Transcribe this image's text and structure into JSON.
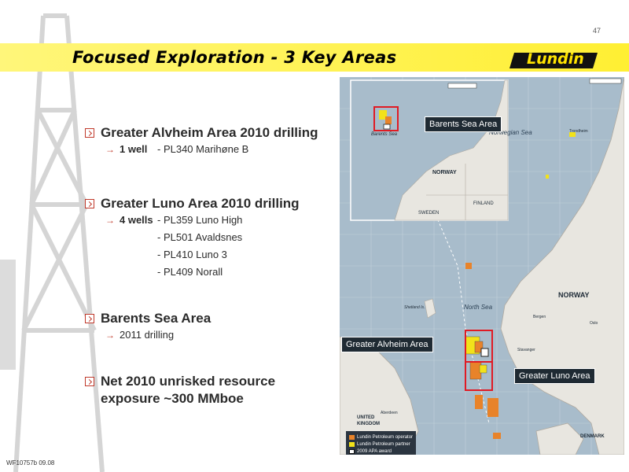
{
  "page_number": "47",
  "title": "Focused Exploration - 3 Key Areas",
  "logo_text": "Lundin",
  "bullets": [
    {
      "text": "Greater Alvheim Area 2010 drilling"
    },
    {
      "text": "Greater Luno Area 2010 drilling"
    },
    {
      "text": "Barents Sea Area"
    },
    {
      "text": "Net 2010 unrisked resource"
    }
  ],
  "bullet4_line2": "exposure  ~300 MMboe",
  "alvheim": {
    "count": "1 well",
    "wells": [
      "- PL340 Marihøne B"
    ]
  },
  "luno": {
    "count": "4 wells",
    "wells": [
      "- PL359  Luno High",
      "- PL501  Avaldsnes",
      "- PL410  Luno 3",
      "- PL409  Norall"
    ]
  },
  "barents": {
    "sub": "2011 drilling"
  },
  "footer": "WF10757b 09.08",
  "map": {
    "callouts": {
      "barents": "Barents Sea Area",
      "alvheim": "Greater Alvheim Area",
      "luno": "Greater Luno Area"
    },
    "labels": {
      "norwegian_sea": "Norwegian Sea",
      "north_sea": "North Sea",
      "norway_main": "NORWAY",
      "norway_inset": "NORWAY",
      "finland": "FINLAND",
      "sweden": "SWEDEN",
      "barents_sea": "Barents Sea",
      "uk_line1": "UNITED",
      "uk_line2": "KINGDOM",
      "denmark": "DENMARK",
      "trondheim": "Trondheim",
      "bergen": "Bergen",
      "oslo": "Oslo",
      "stavanger": "Stavanger",
      "aberdeen": "Aberdeen",
      "shetland": "Shetland Is."
    },
    "legend": [
      {
        "label": "Lundin Petroleum operator",
        "color": "#e8832a"
      },
      {
        "label": "Lundin Petroleum partner",
        "color": "#f2e21a"
      },
      {
        "label": "2009 APA award",
        "color": "#ffffff"
      }
    ]
  },
  "colors": {
    "accent_red": "#c0392b",
    "title_yellow": "#fff33d",
    "land": "#e8e6e0",
    "sea": "#a8bccb"
  }
}
